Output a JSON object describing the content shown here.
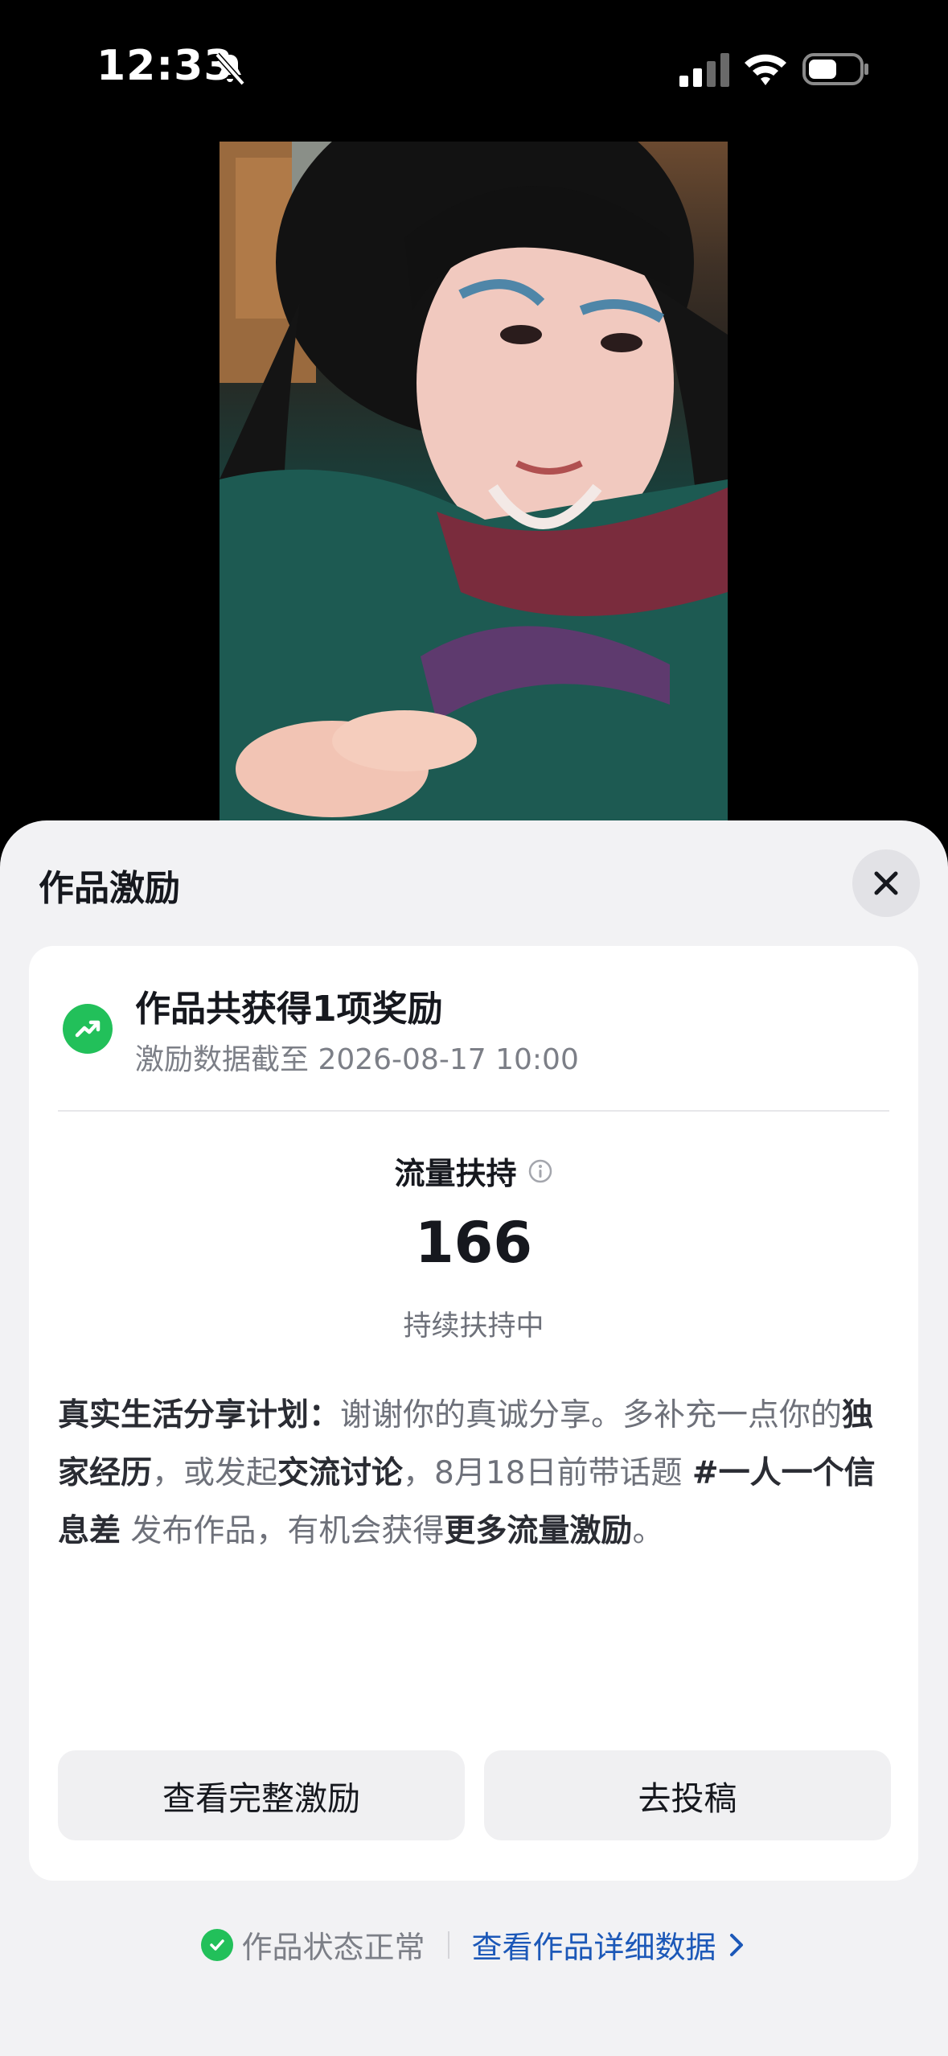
{
  "status_bar": {
    "time": "12:33"
  },
  "sheet": {
    "title": "作品激励",
    "reward": {
      "title": "作品共获得1项奖励",
      "subtitle": "激励数据截至 2026-08-17 10:00"
    },
    "metric": {
      "label": "流量扶持",
      "value": "166",
      "status": "持续扶持中"
    },
    "plan": {
      "lead": "真实生活分享计划：",
      "t1": "谢谢你的真诚分享。多补充一点你的",
      "b1": "独家经历",
      "t2": "，或发起",
      "b2": "交流讨论",
      "t3": "，8月18日前带话题 ",
      "b3": "#一人一个信息差",
      "t4": " 发布作品，有机会获得",
      "b4": "更多流量激励",
      "t5": "。"
    },
    "buttons": {
      "view_full": "查看完整激励",
      "submit": "去投稿"
    },
    "footer": {
      "status": "作品状态正常",
      "link": "查看作品详细数据"
    }
  },
  "colors": {
    "accent_green": "#22c05a",
    "link_blue": "#1c58b8",
    "sheet_bg": "#f2f2f4"
  }
}
